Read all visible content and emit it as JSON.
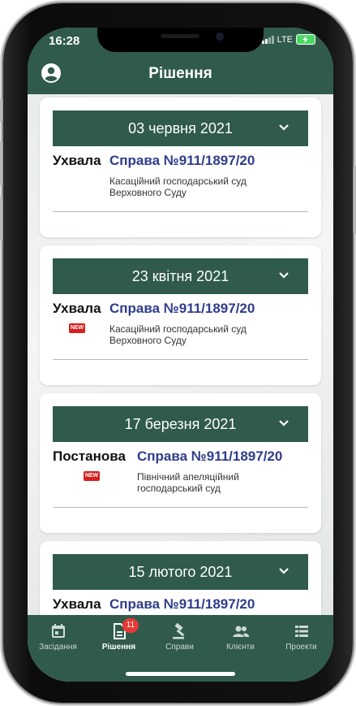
{
  "status": {
    "time": "16:28",
    "network": "LTE"
  },
  "header": {
    "title": "Рішення",
    "avatar_icon": "account-circle-icon"
  },
  "cards": [
    {
      "date": "03 червня 2021",
      "type": "Ухвала",
      "case": "Справа №911/1897/20",
      "court": "Касаційний господарський суд Верховного Суду",
      "is_new": false
    },
    {
      "date": "23 квітня 2021",
      "type": "Ухвала",
      "case": "Справа №911/1897/20",
      "court": "Касаційний господарський суд Верховного Суду",
      "is_new": true
    },
    {
      "date": "17 березня 2021",
      "type": "Постанова",
      "case": "Справа №911/1897/20",
      "court": "Північний апеляційний господарський суд",
      "is_new": true
    },
    {
      "date": "15 лютого 2021",
      "type": "Ухвала",
      "case": "Справа №911/1897/20",
      "court": "",
      "is_new": false
    }
  ],
  "new_badge_label": "NEW",
  "tabs": [
    {
      "label": "Засідання",
      "icon": "calendar-icon",
      "active": false
    },
    {
      "label": "Рішення",
      "icon": "document-icon",
      "active": true,
      "badge": "11"
    },
    {
      "label": "Справи",
      "icon": "gavel-icon",
      "active": false
    },
    {
      "label": "Клієнти",
      "icon": "people-icon",
      "active": false
    },
    {
      "label": "Проекти",
      "icon": "list-icon",
      "active": false
    }
  ],
  "colors": {
    "primary": "#2f5a4c",
    "link": "#2e3c8c",
    "badge": "#e53935",
    "new": "#d71f1f"
  }
}
